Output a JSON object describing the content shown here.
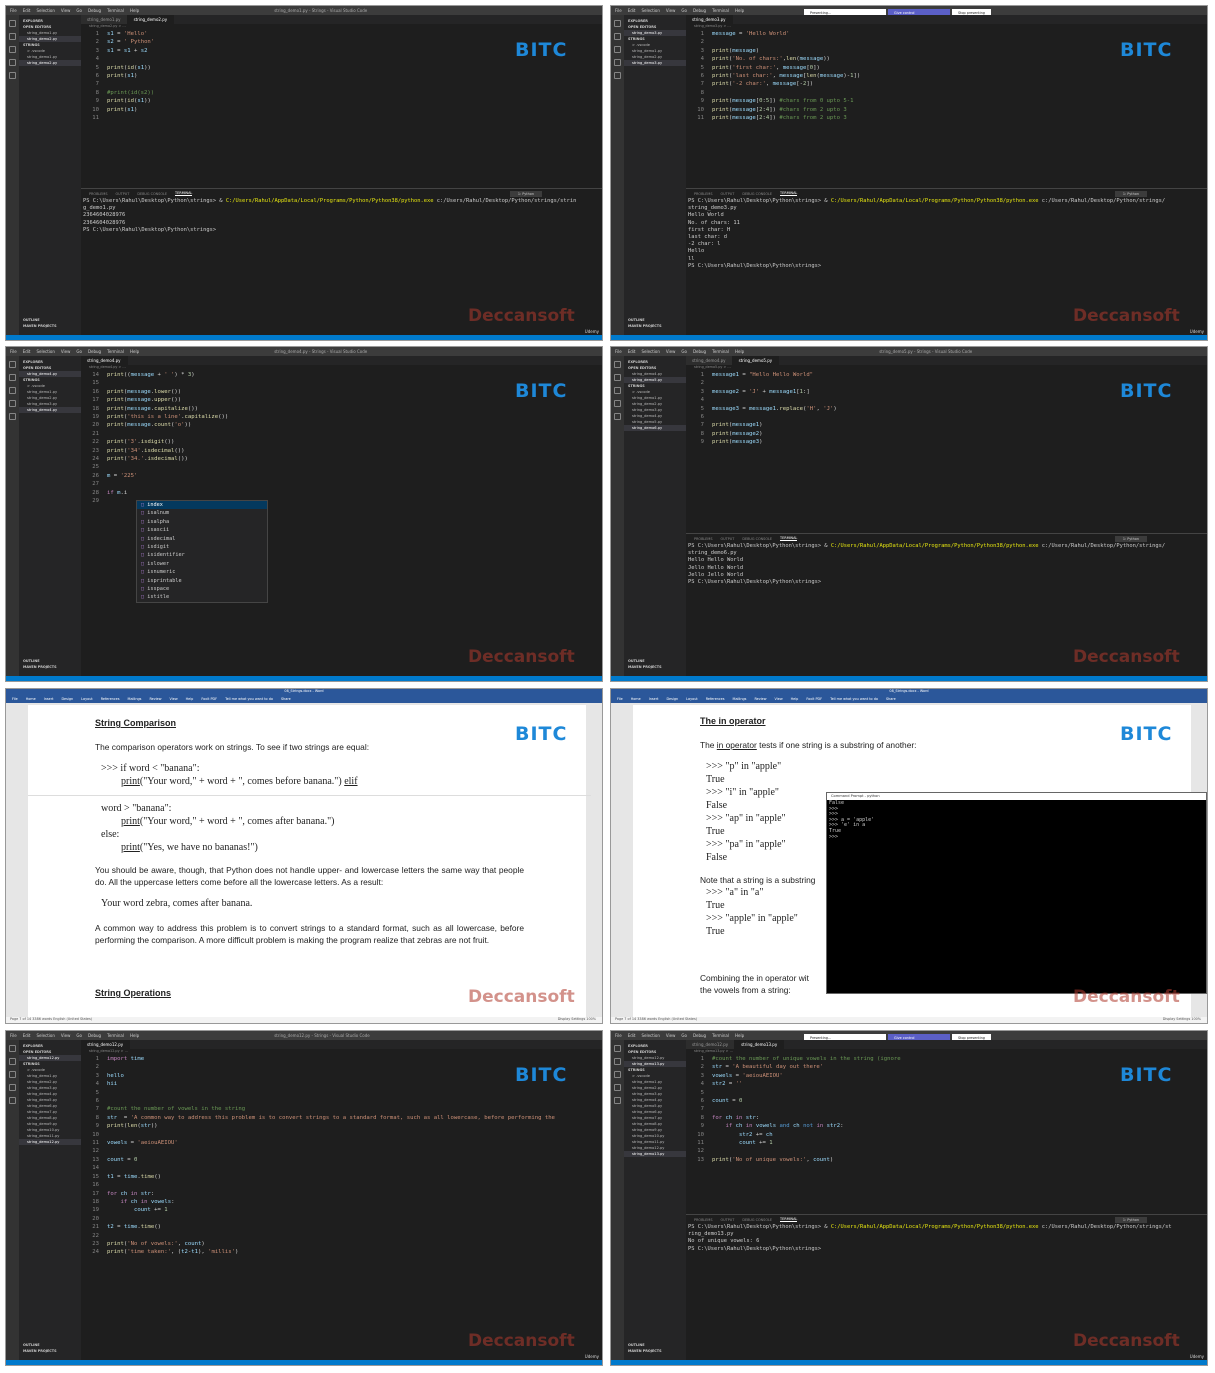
{
  "common": {
    "watermark_brand": "BITC",
    "watermark_publisher": "Deccansoft",
    "platform": "Udemy",
    "vs_menu": [
      "File",
      "Edit",
      "Selection",
      "View",
      "Go",
      "Debug",
      "Terminal",
      "Help"
    ],
    "term_tabs": [
      "PROBLEMS",
      "OUTPUT",
      "DEBUG CONSOLE",
      "TERMINAL"
    ],
    "shell": "1: Python",
    "explorer": "EXPLORER",
    "open_editors": "OPEN EDITORS",
    "strings_folder": "STRINGS",
    "vscode_folder": "> .vscode",
    "outline": "OUTLINE",
    "maven": "MAVEN PROJECTS",
    "presenting": "Presenting...",
    "give_control": "Give control",
    "stop_presenting": "Stop presenting"
  },
  "tile1": {
    "window_title": "string_demo1.py - Strings - Visual Studio Code",
    "tabs": [
      "string_demo1.py",
      "string_demo2.py"
    ],
    "files": [
      "string_demo1.py",
      "string_demo2.py"
    ],
    "terminal": [
      "PS C:\\Users\\Rahul\\Desktop\\Python\\strings> & C:/Users/Rahul/AppData/Local/Programs/Python/Python38/python.exe c:/Users/Rahul/Desktop/Python/strings/strin",
      "g_demo1.py",
      "2364604028976",
      "2364604028976",
      "PS C:\\Users\\Rahul\\Desktop\\Python\\strings> "
    ]
  },
  "tile2": {
    "tabs": [
      "string_demo3.py"
    ],
    "files": [
      "string_demo1.py",
      "string_demo2.py",
      "string_demo3.py"
    ],
    "terminal": [
      "PS C:\\Users\\Rahul\\Desktop\\Python\\strings> & C:/Users/Rahul/AppData/Local/Programs/Python/Python38/python.exe c:/Users/Rahul/Desktop/Python/strings/",
      "string_demo3.py",
      "Hello World",
      "No. of chars: 11",
      "first char: H",
      "last char: d",
      "-2 char: l",
      "Hello",
      "ll",
      "PS C:\\Users\\Rahul\\Desktop\\Python\\strings> "
    ]
  },
  "tile3": {
    "window_title": "string_demo4.py - Strings - Visual Studio Code",
    "tabs": [
      "string_demo4.py"
    ],
    "files": [
      "string_demo1.py",
      "string_demo2.py",
      "string_demo3.py",
      "string_demo4.py"
    ],
    "autocomplete": [
      "index",
      "isalnum",
      "isalpha",
      "isascii",
      "isdecimal",
      "isdigit",
      "isidentifier",
      "islower",
      "isnumeric",
      "isprintable",
      "isspace",
      "istitle"
    ]
  },
  "tile4": {
    "window_title": "string_demo5.py - Strings - Visual Studio Code",
    "tabs": [
      "string_demo4.py",
      "string_demo5.py"
    ],
    "files": [
      "string_demo1.py",
      "string_demo2.py",
      "string_demo3.py",
      "string_demo4.py",
      "string_demo5.py",
      "string_demo6.py"
    ],
    "terminal": [
      "PS C:\\Users\\Rahul\\Desktop\\Python\\strings> & C:/Users/Rahul/AppData/Local/Programs/Python/Python38/python.exe c:/Users/Rahul/Desktop/Python/strings/",
      "string_demo6.py",
      "Hello Hello World",
      "Jello Hello World",
      "Jello Jello World",
      "PS C:\\Users\\Rahul\\Desktop\\Python\\strings> "
    ]
  },
  "tile5": {
    "title": "08_Strings.docx - Word",
    "ribbon": [
      "File",
      "Home",
      "Insert",
      "Design",
      "Layout",
      "References",
      "Mailings",
      "Review",
      "View",
      "Help",
      "Foxit PDF",
      "Tell me what you want to do",
      "Share"
    ],
    "heading": "String Comparison",
    "p1": "The comparison operators work on strings. To see if two strings are equal:",
    "c1": ">>> if word < \"banana\":",
    "c2a": "print",
    "c2b": "(\"Your word,\" + word + \", comes before banana.\") ",
    "c2c": "elif",
    "c3": "word > \"banana\":",
    "c4a": "print",
    "c4b": "(\"Your word,\" + word + \", comes after banana.\")",
    "c5": "else:",
    "c6a": "print",
    "c6b": "(\"Yes, we have no bananas!\")",
    "p2": "You should be aware, though, that Python does not handle upper- and lowercase letters the same way that people do. All the uppercase letters come before all the lowercase letters. As a result:",
    "c7": "Your word zebra, comes after banana.",
    "p3": "A common way to address this problem is to convert strings to a standard format, such as all lowercase, before performing the comparison. A more difficult problem is making the program realize that zebras are not fruit.",
    "heading2": "String Operations",
    "status": "Page 7 of 14    3386 words    English (United States)",
    "status_right": "Display Settings    100%"
  },
  "tile6": {
    "title": "08_Strings.docx - Word",
    "ribbon": [
      "File",
      "Home",
      "Insert",
      "Design",
      "Layout",
      "References",
      "Mailings",
      "Review",
      "View",
      "Help",
      "Foxit PDF",
      "Tell me what you want to do",
      "Share"
    ],
    "heading_a": "The ",
    "heading_b": "in",
    "heading_c": " operator",
    "p1a": "The ",
    "p1b": "in operator",
    "p1c": " tests if one string is a substring of another:",
    "lines": [
      ">>> \"p\" in \"apple\"",
      "True",
      ">>> \"i\" in \"apple\"",
      "False",
      ">>> \"ap\" in \"apple\"",
      "True",
      ">>> \"pa\" in \"apple\"",
      "False"
    ],
    "note": "Note that a string is a substring",
    "lines2": [
      ">>> \"a\" in \"a\"",
      "True",
      ">>> \"apple\" in \"apple\"",
      "True"
    ],
    "p_end": "Combining the in operator wit",
    "p_end2": "the vowels from a string:",
    "cmd_title": "Command Prompt - python",
    "cmd_body": "False\n>>>\n>>>\n>>> a = 'apple'\n>>> 'e' in a\nTrue\n>>>",
    "status": "Page 7 of 14    3386 words    English (United States)",
    "status_right": "Display Settings    100%"
  },
  "tile7": {
    "window_title": "string_demo12.py - Strings - Visual Studio Code",
    "tabs": [
      "string_demo12.py"
    ],
    "files": [
      "string_demo1.py",
      "string_demo2.py",
      "string_demo3.py",
      "string_demo4.py",
      "string_demo5.py",
      "string_demo6.py",
      "string_demo7.py",
      "string_demo8.py",
      "string_demo9.py",
      "string_demo10.py",
      "string_demo11.py",
      "string_demo12.py"
    ]
  },
  "tile8": {
    "tabs": [
      "string_demo12.py",
      "string_demo13.py"
    ],
    "files": [
      "string_demo1.py",
      "string_demo2.py",
      "string_demo3.py",
      "string_demo4.py",
      "string_demo5.py",
      "string_demo6.py",
      "string_demo7.py",
      "string_demo8.py",
      "string_demo9.py",
      "string_demo10.py",
      "string_demo11.py",
      "string_demo12.py",
      "string_demo13.py"
    ],
    "terminal": [
      "PS C:\\Users\\Rahul\\Desktop\\Python\\strings> & C:/Users/Rahul/AppData/Local/Programs/Python/Python38/python.exe c:/Users/Rahul/Desktop/Python/strings/st",
      "ring_demo13.py",
      "No of unique vowels: 6",
      "PS C:\\Users\\Rahul\\Desktop\\Python\\strings> "
    ]
  }
}
